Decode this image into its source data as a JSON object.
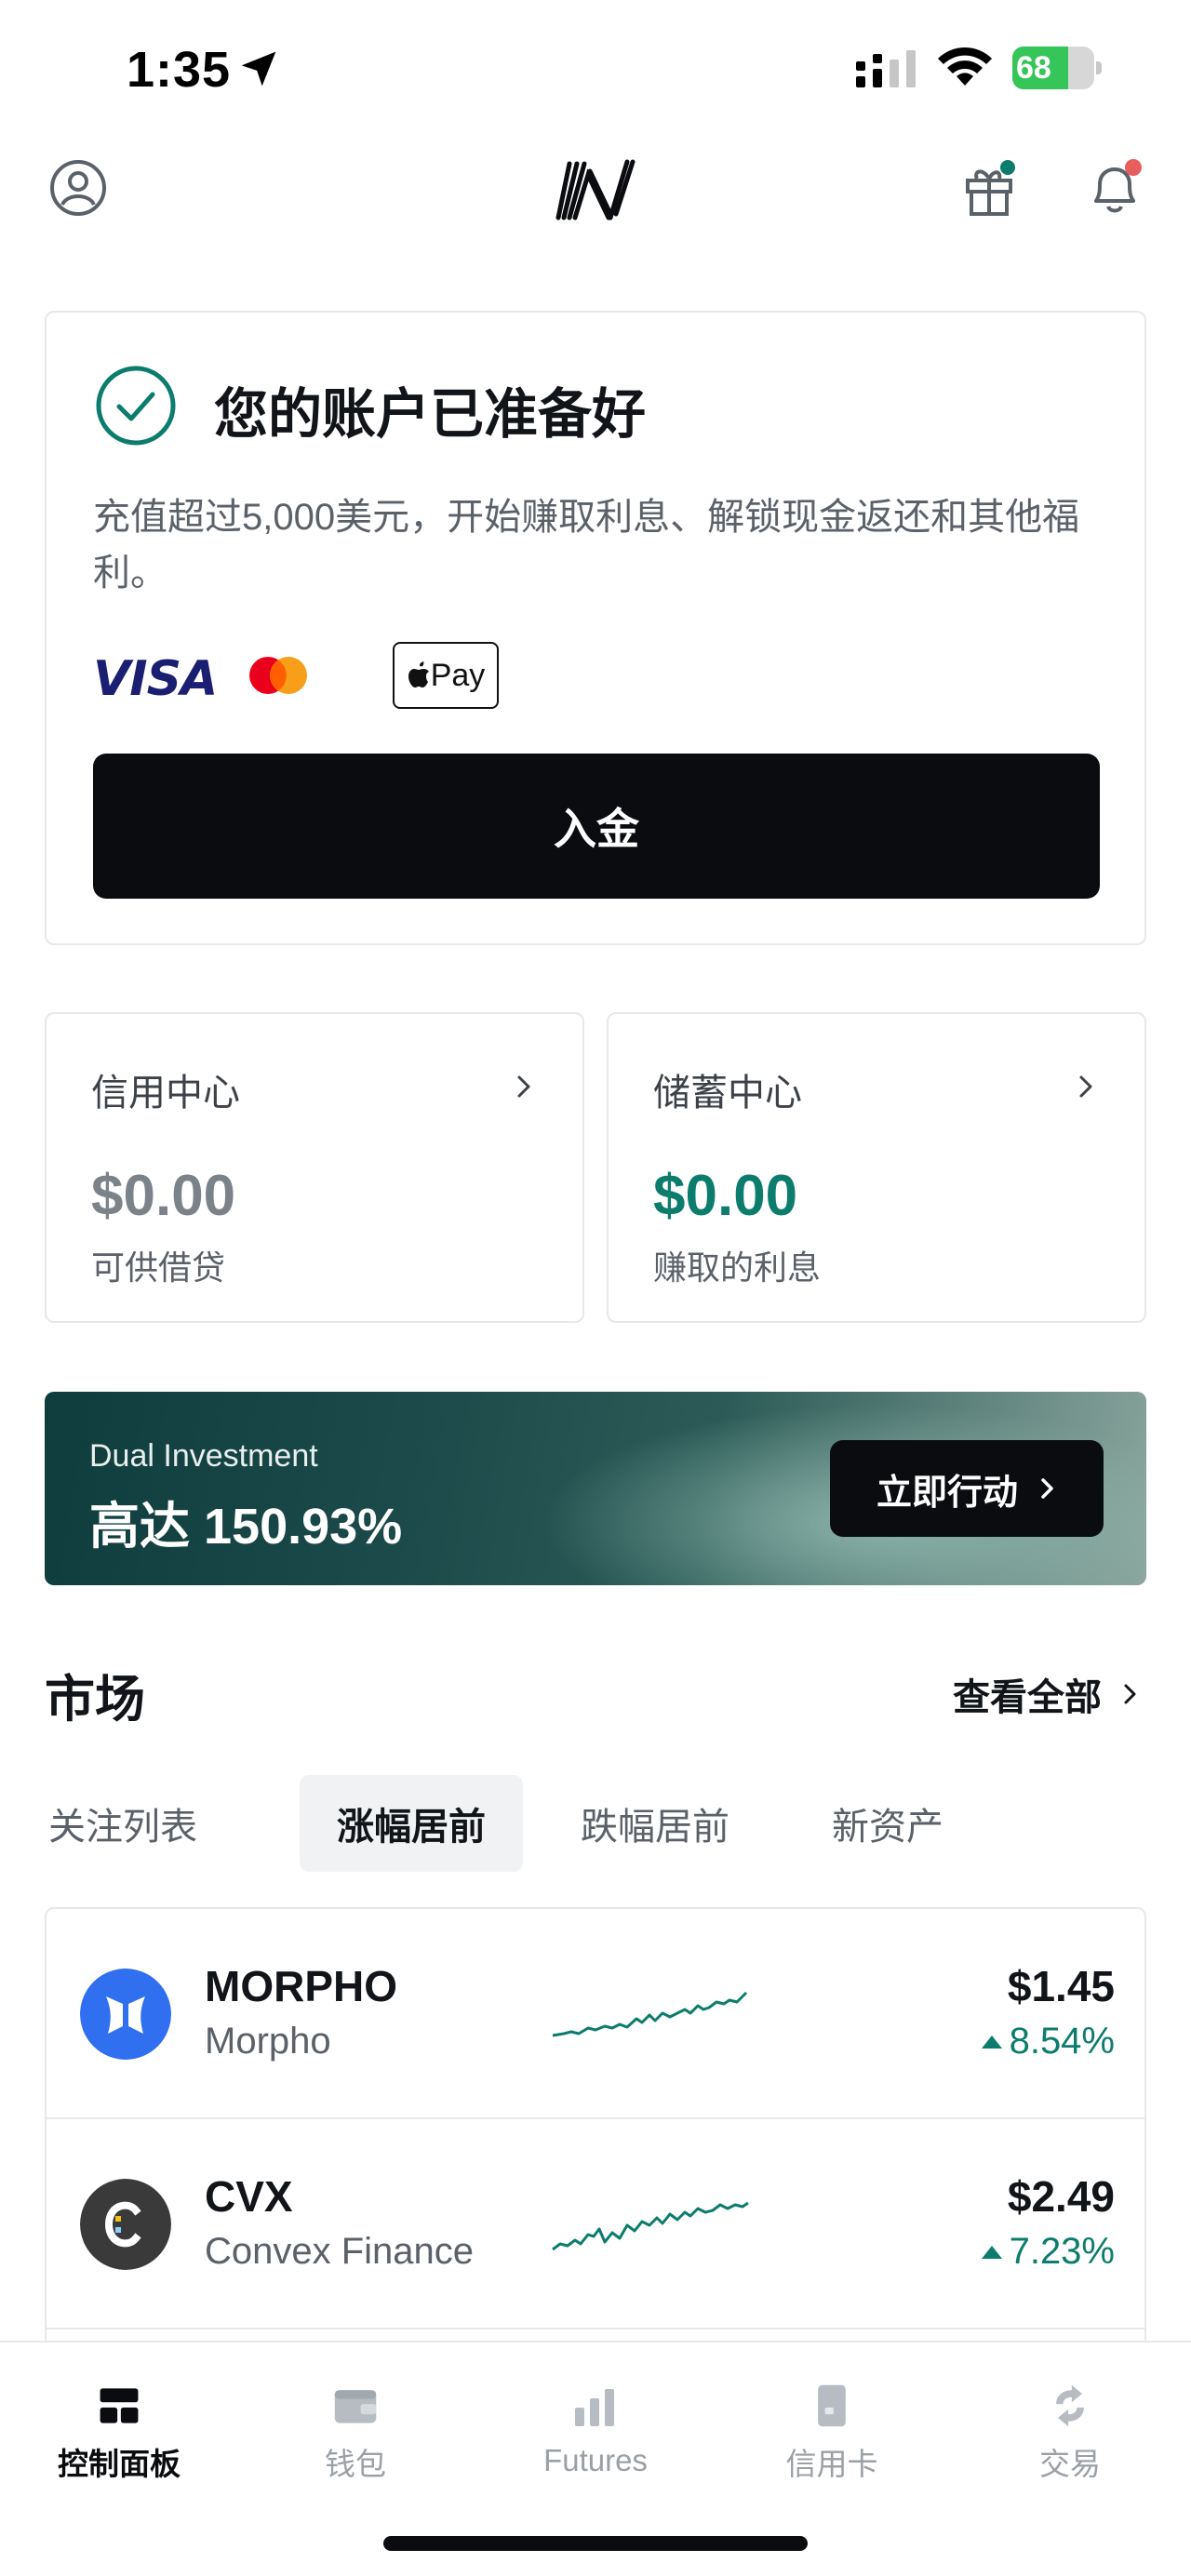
{
  "status_bar": {
    "time": "1:35",
    "battery_percent": "68",
    "battery_level": 0.68
  },
  "header": {
    "icons": [
      "profile-icon",
      "app-logo",
      "gift-icon",
      "bell-icon"
    ],
    "gift_has_dot": true,
    "bell_has_dot": true,
    "colors": {
      "gift_dot": "#0c7c6d",
      "bell_dot": "#e85d5d"
    }
  },
  "ready_card": {
    "title": "您的账户已准备好",
    "description": "充值超过5,000美元，开始赚取利息、解锁现金返还和其他福利。",
    "payment_methods": {
      "visa": "VISA",
      "mastercard": "mastercard-logo",
      "apple_pay": "Pay"
    },
    "deposit_label": "入金"
  },
  "centers": {
    "credit": {
      "title": "信用中心",
      "amount": "$0.00",
      "subtitle": "可供借贷"
    },
    "savings": {
      "title": "储蓄中心",
      "amount": "$0.00",
      "subtitle": "赚取的利息"
    }
  },
  "promo": {
    "subtitle": "Dual Investment",
    "title": "高达 150.93%",
    "button_label": "立即行动"
  },
  "market": {
    "title": "市场",
    "view_all": "查看全部",
    "tabs": [
      {
        "label": "关注列表",
        "active": false
      },
      {
        "label": "涨幅居前",
        "active": true
      },
      {
        "label": "跌幅居前",
        "active": false
      },
      {
        "label": "新资产",
        "active": false
      }
    ],
    "rows": [
      {
        "symbol": "MORPHO",
        "name": "Morpho",
        "price": "$1.45",
        "change": "8.54%",
        "icon": "morpho-icon",
        "icon_color": "#2f6ff0"
      },
      {
        "symbol": "CVX",
        "name": "Convex Finance",
        "price": "$2.49",
        "change": "7.23%",
        "icon": "cvx-icon",
        "icon_color": "#3a3a3a"
      }
    ]
  },
  "tab_bar": {
    "items": [
      {
        "label": "控制面板",
        "icon": "dashboard-icon",
        "active": true
      },
      {
        "label": "钱包",
        "icon": "wallet-icon",
        "active": false
      },
      {
        "label": "Futures",
        "icon": "futures-icon",
        "active": false
      },
      {
        "label": "信用卡",
        "icon": "credit-card-icon",
        "active": false
      },
      {
        "label": "交易",
        "icon": "trade-icon",
        "active": false
      }
    ]
  },
  "colors": {
    "accent_green": "#0c7c6d",
    "button_dark": "#0a0c10",
    "text_muted": "#5b6169",
    "border": "#e6e9ec"
  }
}
